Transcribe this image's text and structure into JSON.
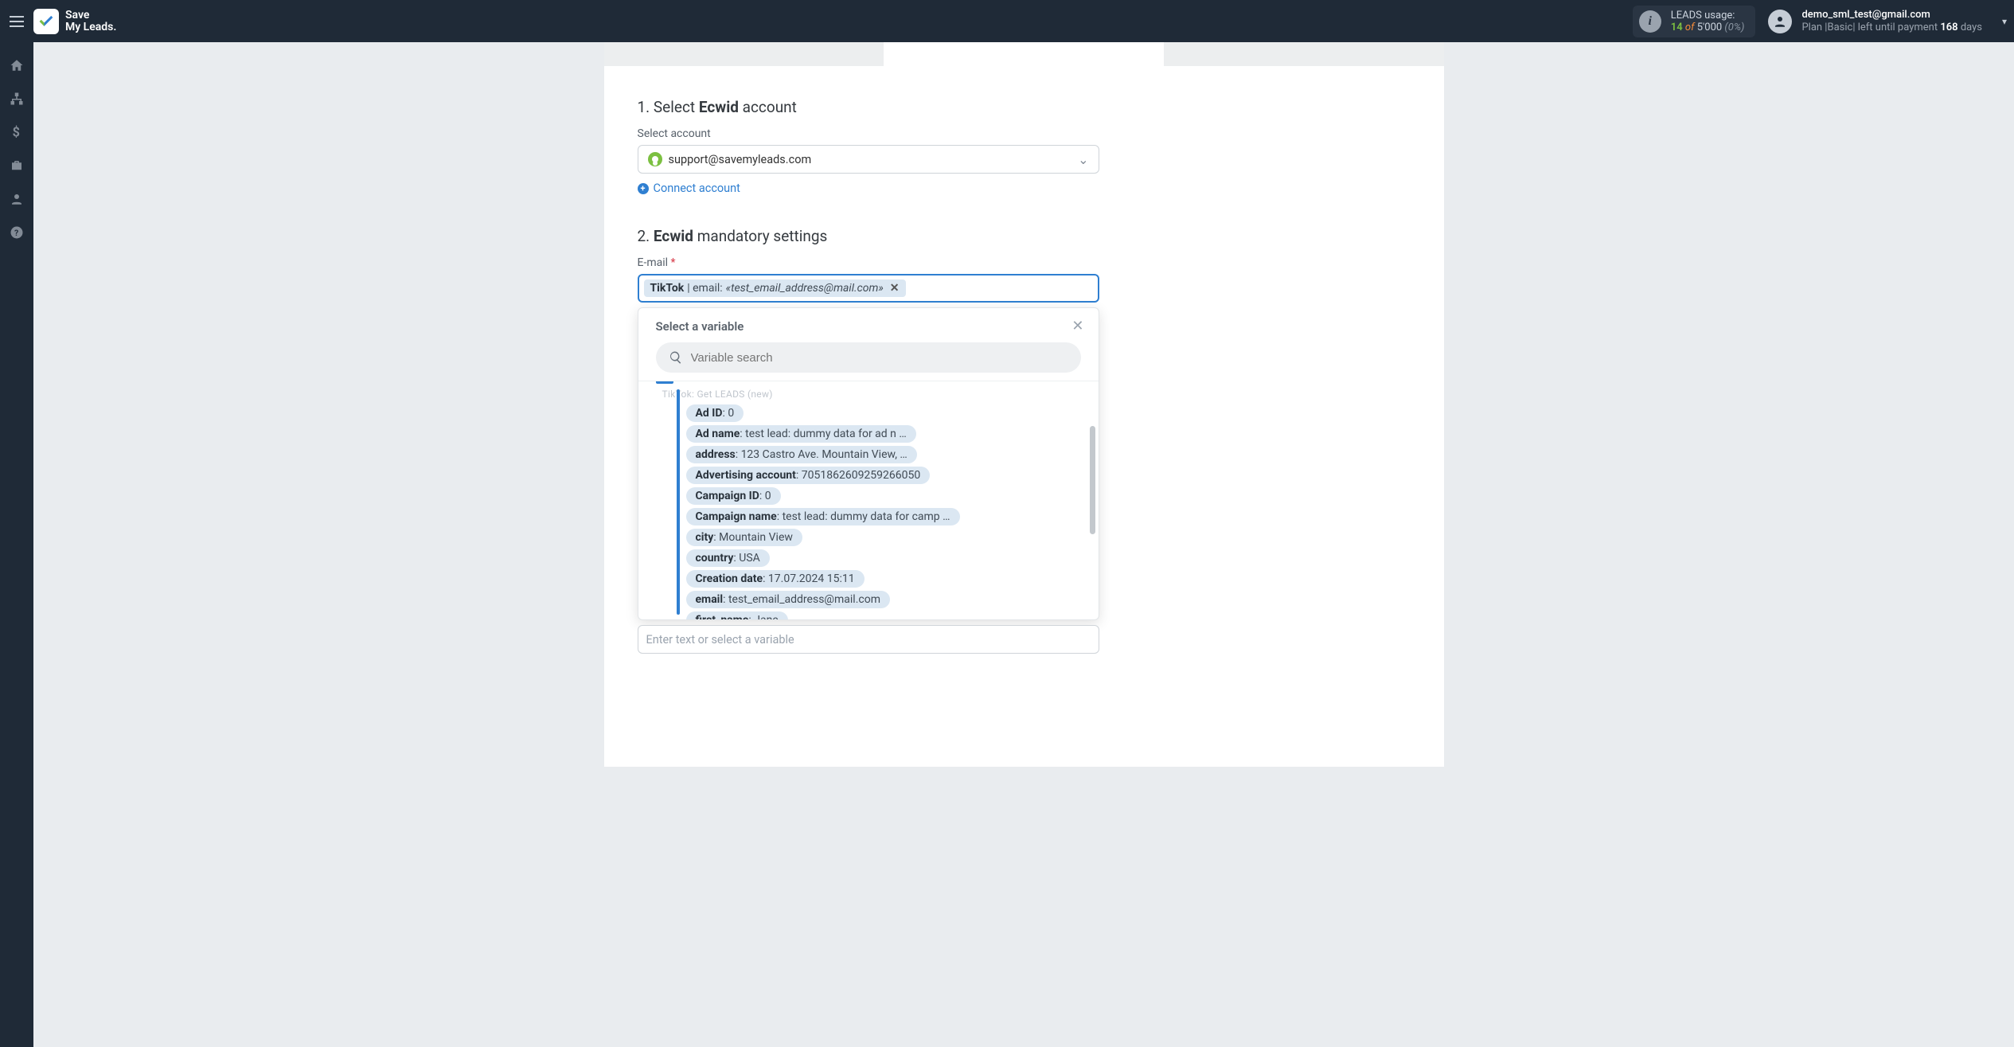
{
  "brand": {
    "line1": "Save",
    "line2": "My Leads."
  },
  "leads_usage": {
    "label": "LEADS usage:",
    "current": "14",
    "of_word": "of",
    "cap": "5'000",
    "pct": "(0%)"
  },
  "user": {
    "email": "demo_sml_test@gmail.com",
    "plan_prefix": "Plan |",
    "plan_name": "Basic",
    "plan_mid": "| left until payment ",
    "days": "168",
    "days_unit": " days"
  },
  "steps": {
    "s1_prefix": "1. Select ",
    "s1_bold": "Ecwid",
    "s1_suffix": " account",
    "s2_prefix": "2. ",
    "s2_bold": "Ecwid",
    "s2_suffix": " mandatory settings"
  },
  "account_select": {
    "label": "Select account",
    "value": "support@savemyleads.com",
    "connect": "Connect account"
  },
  "email_field": {
    "label": "E-mail",
    "chip_source": "TikTok",
    "chip_sep": " | email: ",
    "chip_value": "«test_email_address@mail.com»"
  },
  "picker": {
    "title": "Select a variable",
    "search_placeholder": "Variable search",
    "source_label": "TikTok: Get LEADS (new)",
    "variables": [
      {
        "name": "Ad ID",
        "value": "0"
      },
      {
        "name": "Ad name",
        "value": "test lead: dummy data for ad n …"
      },
      {
        "name": "address",
        "value": "123 Castro Ave. Mountain View, …"
      },
      {
        "name": "Advertising account",
        "value": "7051862609259266050"
      },
      {
        "name": "Campaign ID",
        "value": "0"
      },
      {
        "name": "Campaign name",
        "value": "test lead: dummy data for camp …"
      },
      {
        "name": "city",
        "value": "Mountain View"
      },
      {
        "name": "country",
        "value": "USA"
      },
      {
        "name": "Creation date",
        "value": "17.07.2024 15:11"
      },
      {
        "name": "email",
        "value": "test_email_address@mail.com"
      },
      {
        "name": "first_name",
        "value": "Jane"
      }
    ]
  },
  "footer_placeholder": "Enter text or select a variable"
}
